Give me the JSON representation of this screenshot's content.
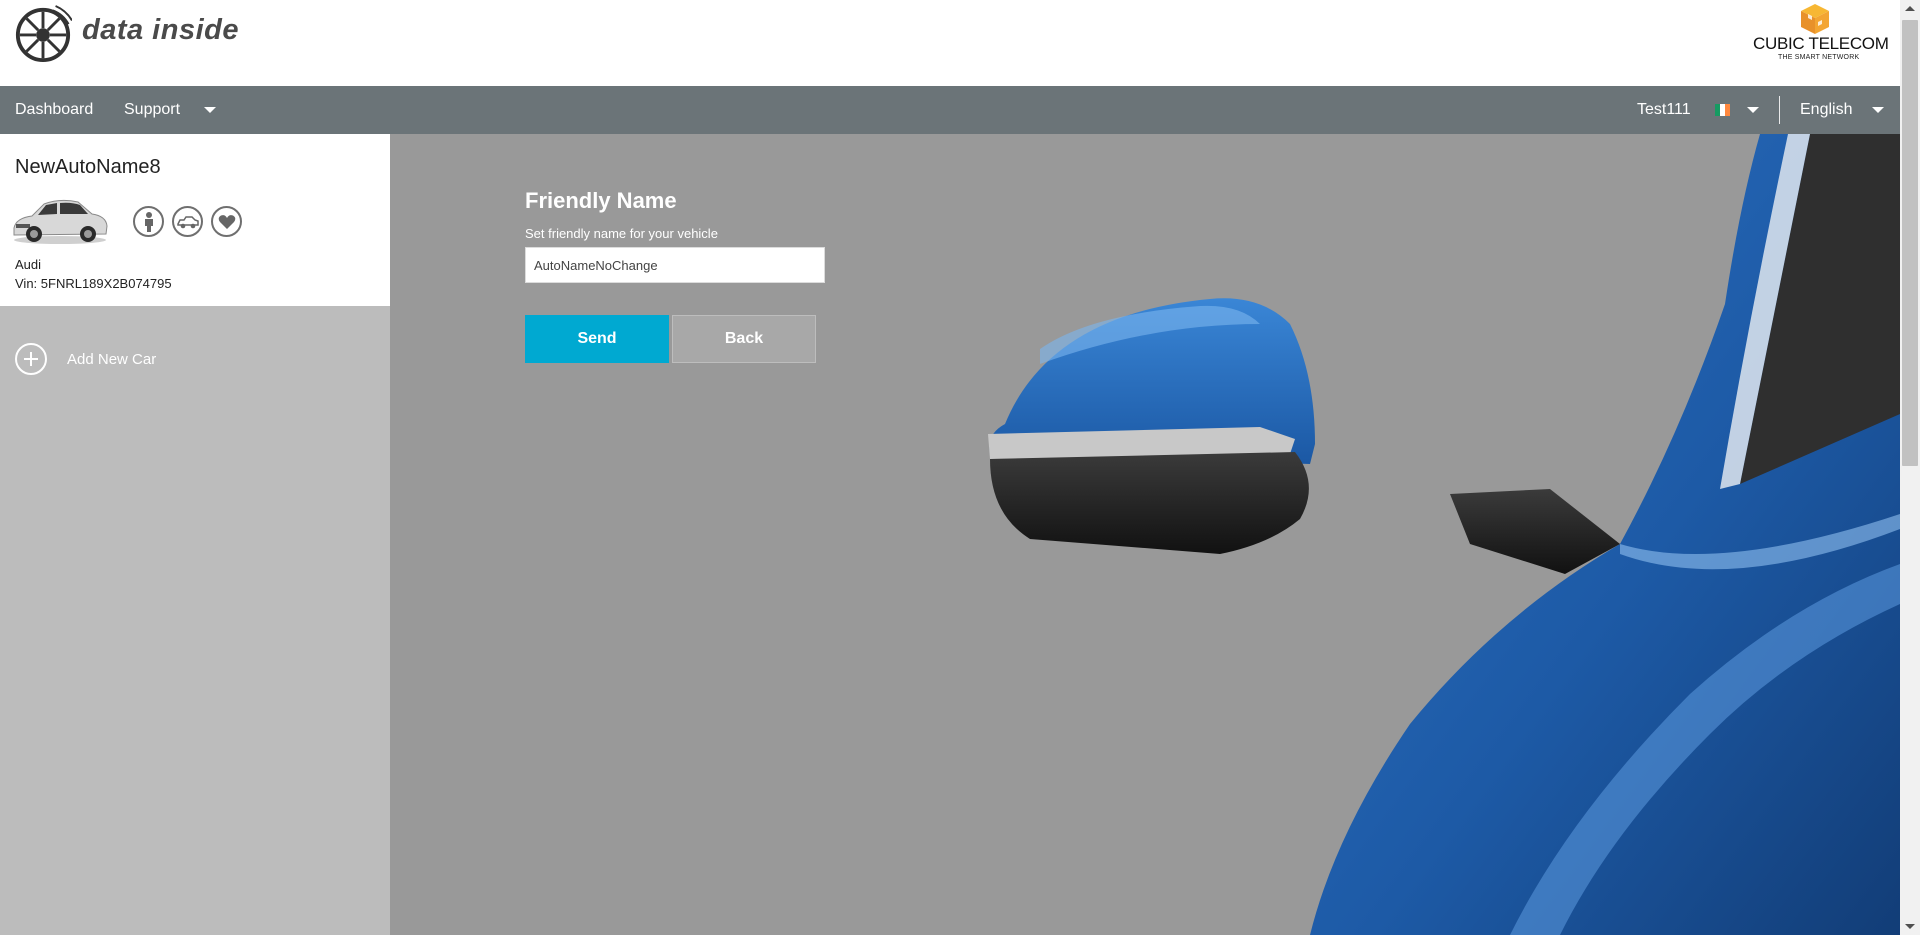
{
  "brand": {
    "logo_text": "data inside",
    "partner_name": "CUBIC TELECOM",
    "partner_tagline": "THE SMART NETWORK"
  },
  "nav": {
    "dashboard": "Dashboard",
    "support": "Support",
    "user": "Test111",
    "language": "English",
    "flag_colors": [
      "#169b62",
      "#ffffff",
      "#ff883e"
    ]
  },
  "vehicle": {
    "name": "NewAutoName8",
    "make": "Audi",
    "vin": "Vin: 5FNRL189X2B074795",
    "actions": [
      "driver-icon",
      "car-icon",
      "heart-icon"
    ]
  },
  "sidebar": {
    "add_new_car": "Add New Car"
  },
  "form": {
    "title": "Friendly Name",
    "label": "Set friendly name for your vehicle",
    "value": "AutoNameNoChange",
    "send_label": "Send",
    "back_label": "Back"
  },
  "colors": {
    "accent": "#00a9d1",
    "navbar": "#6b7478",
    "background": "#999999",
    "car_blue": "#1f5fae"
  }
}
